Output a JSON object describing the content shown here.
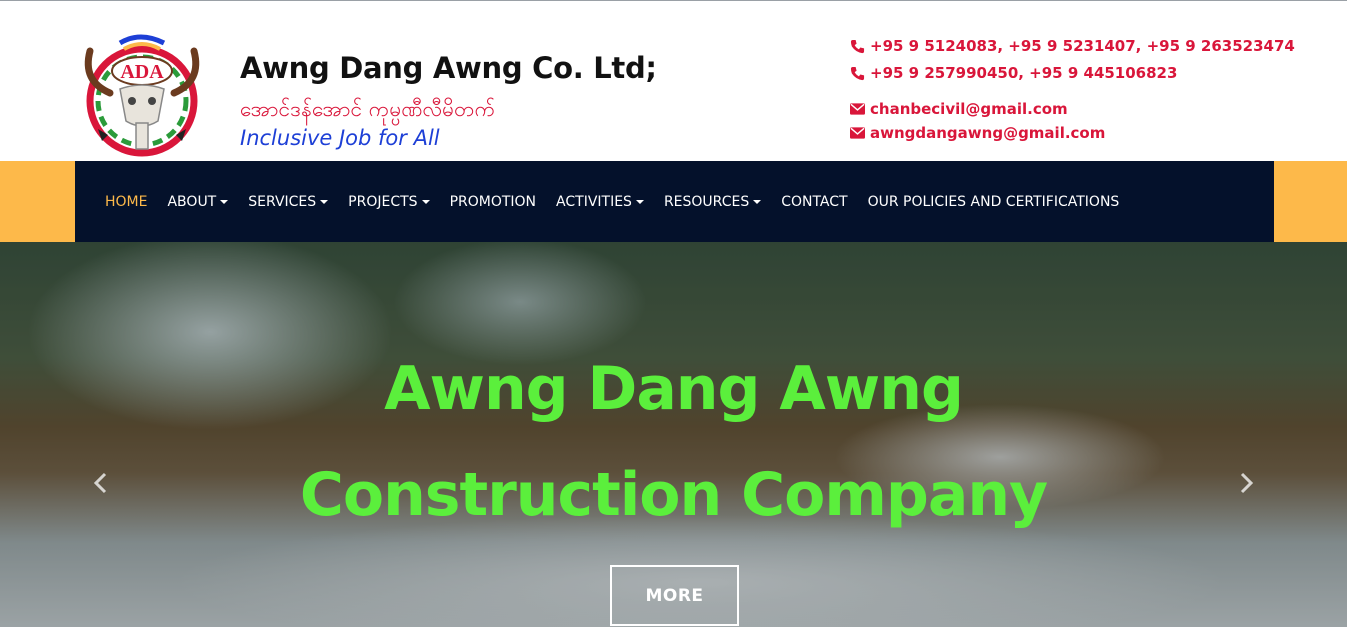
{
  "header": {
    "brand_title": "Awng Dang Awng Co. Ltd;",
    "brand_myanmar": "အောင်ဒန်အောင် ကုမ္ပဏီလီမိတက်",
    "tagline": "Inclusive Job for All",
    "logo_text": "ADA",
    "contacts": [
      {
        "icon": "phone-icon",
        "text": "+95 9 5124083, +95 9 5231407, +95 9 263523474"
      },
      {
        "icon": "phone-icon",
        "text": "+95 9 257990450, +95 9 445106823"
      },
      {
        "icon": "envelope-icon",
        "text": "chanbecivil@gmail.com"
      },
      {
        "icon": "envelope-icon",
        "text": "awngdangawng@gmail.com"
      }
    ]
  },
  "nav": {
    "items": [
      {
        "label": "HOME",
        "active": true,
        "dropdown": false
      },
      {
        "label": "ABOUT",
        "active": false,
        "dropdown": true
      },
      {
        "label": "SERVICES",
        "active": false,
        "dropdown": true
      },
      {
        "label": "PROJECTS",
        "active": false,
        "dropdown": true
      },
      {
        "label": "PROMOTION",
        "active": false,
        "dropdown": false
      },
      {
        "label": "ACTIVITIES",
        "active": false,
        "dropdown": true
      },
      {
        "label": "RESOURCES",
        "active": false,
        "dropdown": true
      },
      {
        "label": "CONTACT",
        "active": false,
        "dropdown": false
      },
      {
        "label": "OUR POLICIES AND CERTIFICATIONS",
        "active": false,
        "dropdown": false
      }
    ]
  },
  "hero": {
    "line1": "Awng Dang Awng",
    "line2": "Construction Company",
    "button": "MORE"
  },
  "colors": {
    "accent": "#fdb94a",
    "nav_bg": "#04112b",
    "contact_red": "#d9163a",
    "hero_green": "#5bef3c",
    "tagline_blue": "#1d3fd6"
  }
}
